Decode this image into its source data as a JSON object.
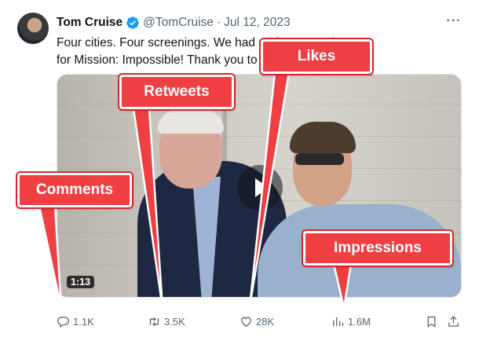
{
  "tweet": {
    "author_name": "Tom Cruise",
    "author_handle": "@TomCruise",
    "separator": "·",
    "date": "Jul 12, 2023",
    "more_label": "···",
    "text_line1": "Four cities. Four screenings. We had s                              t fan screenings",
    "text_line2": "for Mission: Impossible! Thank you to                                    out.",
    "media": {
      "type": "video",
      "duration": "1:13"
    }
  },
  "actions": {
    "comments": "1.1K",
    "retweets": "3.5K",
    "likes": "28K",
    "views": "1.6M"
  },
  "annotations": {
    "likes": "Likes",
    "retweets": "Retweets",
    "comments": "Comments",
    "impressions": "Impressions"
  },
  "icons": {
    "verified": "verified-badge-icon",
    "reply": "reply-icon",
    "retweet": "retweet-icon",
    "like": "heart-icon",
    "views": "bar-chart-icon",
    "bookmark": "bookmark-icon",
    "share": "share-icon",
    "play": "play-icon"
  },
  "colors": {
    "verified": "#1d9bf0",
    "muted_text": "#536471",
    "callout_fill": "#ef3f43",
    "callout_border": "#ffffff"
  }
}
